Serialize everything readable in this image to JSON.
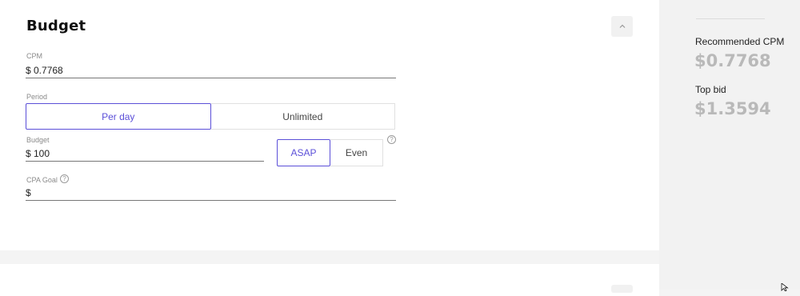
{
  "budget_section": {
    "title": "Budget",
    "cpm": {
      "label": "CPM",
      "value": "$ 0.7768"
    },
    "period": {
      "label": "Period",
      "options": [
        "Per day",
        "Unlimited"
      ],
      "selected": "Per day"
    },
    "budget": {
      "label": "Budget",
      "value": "$ 100"
    },
    "pacing": {
      "options": [
        "ASAP",
        "Even"
      ],
      "selected": "ASAP",
      "help_icon": "?"
    },
    "cpa_goal": {
      "label": "CPA Goal",
      "value": "$",
      "help_icon": "?"
    },
    "collapse_icon": "chevron-up-icon"
  },
  "stats_panel": {
    "recommended_cpm_label": "Recommended CPM",
    "recommended_cpm_value": "$0.7768",
    "top_bid_label": "Top bid",
    "top_bid_value": "$1.3594"
  },
  "colors": {
    "accent": "#5b4fd8",
    "stat_value": "#b9b9b9",
    "panel_bg": "#f2f2f2"
  }
}
